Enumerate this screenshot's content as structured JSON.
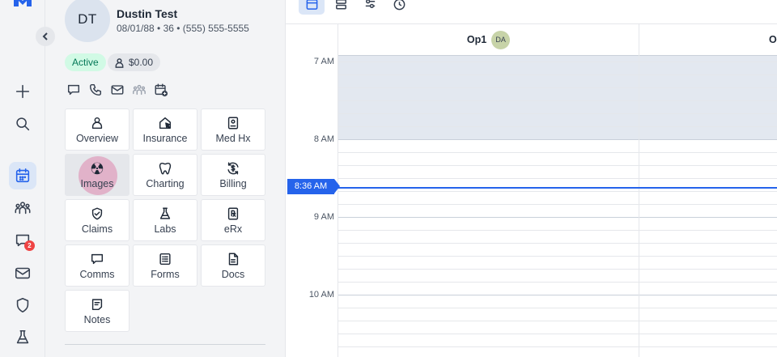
{
  "patient": {
    "initials": "DT",
    "name": "Dustin Test",
    "meta": "08/01/88 • 36 • (555) 555-5555",
    "status": "Active",
    "balance": "$0.00"
  },
  "rail": {
    "messages_badge": "2"
  },
  "tiles": [
    {
      "label": "Overview"
    },
    {
      "label": "Insurance"
    },
    {
      "label": "Med Hx"
    },
    {
      "label": "Images"
    },
    {
      "label": "Charting"
    },
    {
      "label": "Billing"
    },
    {
      "label": "Claims"
    },
    {
      "label": "Labs"
    },
    {
      "label": "eRx"
    },
    {
      "label": "Comms"
    },
    {
      "label": "Forms"
    },
    {
      "label": "Docs"
    },
    {
      "label": "Notes"
    }
  ],
  "calendar": {
    "columns": [
      {
        "name": "Op1",
        "provider": "DA"
      },
      {
        "name": "Op"
      }
    ],
    "times": [
      "7 AM",
      "8 AM",
      "9 AM",
      "10 AM"
    ],
    "now": "8:36 AM"
  },
  "colors": {
    "accent": "#2563eb",
    "active_status": "#047857",
    "badge": "#ef4444"
  }
}
